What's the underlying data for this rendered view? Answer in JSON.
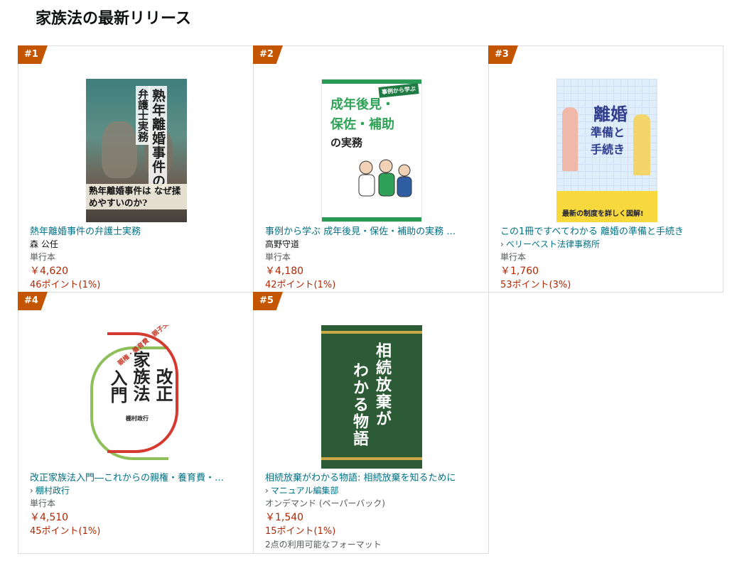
{
  "page": {
    "title": "家族法の最新リリース"
  },
  "items": [
    {
      "rank": "#1",
      "title": "熱年離婚事件の弁護士実務",
      "author": "森 公任",
      "author_link": false,
      "format": "単行本",
      "price": "￥4,620",
      "points": "46ポイント(1%)",
      "cover": {
        "line1": "熟年離婚事件の",
        "line2": "弁護士実務",
        "band": "熟年離婚事件は なぜ揉めやすいのか?"
      }
    },
    {
      "rank": "#2",
      "title": "事例から学ぶ 成年後見・保佐・補助の実務 …",
      "author": "高野守道",
      "author_link": false,
      "format": "単行本",
      "price": "￥4,180",
      "points": "42ポイント(1%)",
      "cover": {
        "tag": "事例から学ぶ",
        "line1": "成年後見・",
        "line2": "保佐・補助",
        "line3": "の実務"
      }
    },
    {
      "rank": "#3",
      "title": "この1冊ですべてわかる 離婚の準備と手続き",
      "author": "ベリーベスト法律事務所",
      "author_link": true,
      "format": "単行本",
      "price": "￥1,760",
      "points": "53ポイント(3%)",
      "cover": {
        "line1": "離婚",
        "line2": "準備と",
        "line3": "手続き",
        "strip": "最新の制度を詳しく図解!"
      }
    },
    {
      "rank": "#4",
      "title": "改正家族法入門―これからの親権・養育費・…",
      "author": "棚村政行",
      "author_link": true,
      "format": "単行本",
      "price": "￥4,510",
      "points": "45ポイント(1%)",
      "cover": {
        "sub": "親権・養育費・親子交流",
        "a": "改正",
        "b": "家族法",
        "c": "入門",
        "author": "棚村政行"
      }
    },
    {
      "rank": "#5",
      "title": "相続放棄がわかる物語: 相続放棄を知るために",
      "author": "マニュアル編集部",
      "author_link": true,
      "format": "オンデマンド (ペーパーバック)",
      "price": "￥1,540",
      "points": "15ポイント(1%)",
      "formats_note": "2点の利用可能なフォーマット",
      "cover": {
        "a": "相続放棄が",
        "b": "わかる物語"
      }
    }
  ],
  "colors": {
    "rank_badge": "#c45500",
    "link": "#007185",
    "price": "#b12704"
  }
}
